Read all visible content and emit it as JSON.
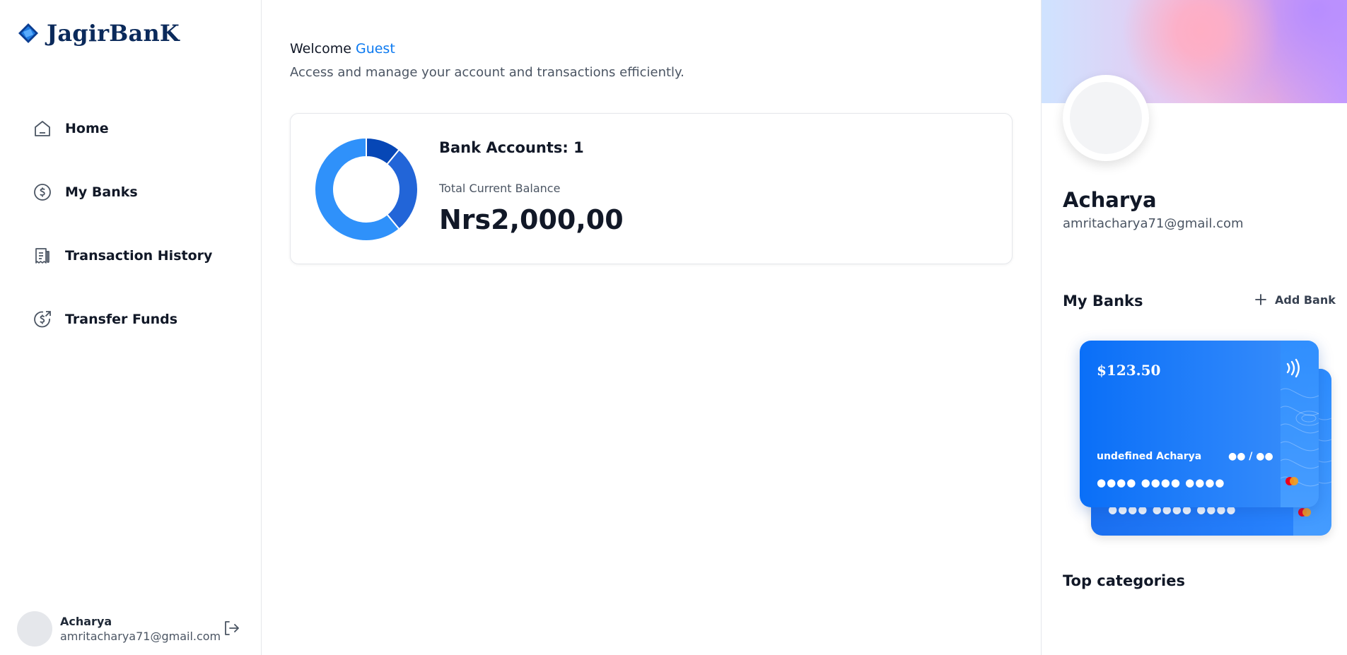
{
  "brand": {
    "name": "JagirBanK"
  },
  "sidebar": {
    "items": [
      {
        "label": "Home",
        "icon": "home-icon"
      },
      {
        "label": "My Banks",
        "icon": "dollar-circle-icon"
      },
      {
        "label": "Transaction History",
        "icon": "receipt-icon"
      },
      {
        "label": "Transfer Funds",
        "icon": "money-send-icon"
      }
    ],
    "footer": {
      "name": "Acharya",
      "email": "amritacharya71@gmail.com"
    }
  },
  "main": {
    "welcome_prefix": "Welcome",
    "welcome_user": "Guest",
    "subtitle": "Access and manage your account and transactions efficiently.",
    "balance": {
      "accounts_label": "Bank Accounts: 1",
      "total_label": "Total Current Balance",
      "total_value": "Nrs2,000,00"
    }
  },
  "chart_data": {
    "type": "pie",
    "values": [
      11,
      28,
      61
    ],
    "colors": [
      "#0747b6",
      "#2265d8",
      "#2f91fa"
    ]
  },
  "right_panel": {
    "profile": {
      "name": "Acharya",
      "email": "amritacharya71@gmail.com"
    },
    "my_banks_title": "My Banks",
    "add_bank_label": "Add Bank",
    "cards": [
      {
        "amount": "$123.50",
        "holder": "undefined Acharya",
        "expiry": "●● / ●●",
        "number": "●●●● ●●●● ●●●●"
      },
      {
        "number": "●●●● ●●●● ●●●●"
      }
    ],
    "top_categories_title": "Top categories"
  },
  "colors": {
    "accent": "#0b79f0",
    "brand_dark": "#0b2a5b",
    "card_blue": "#0a6ff8"
  }
}
